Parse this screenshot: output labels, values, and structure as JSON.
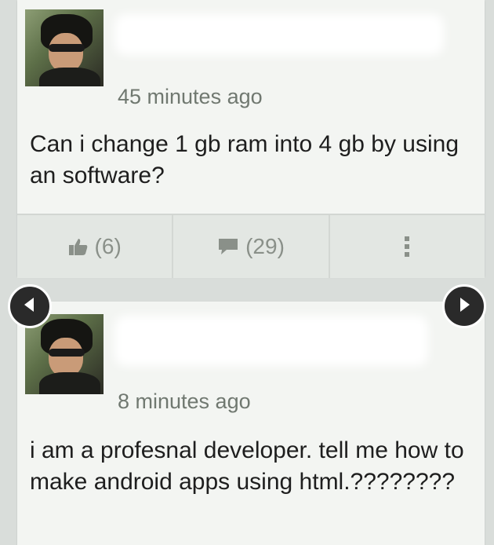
{
  "posts": [
    {
      "time": "45 minutes ago",
      "text": "Can i change 1 gb ram into 4 gb by using an software?",
      "likes": "(6)",
      "comments": "(29)"
    },
    {
      "time": "8 minutes ago",
      "text": "i am a profesnal developer. tell me how to make android apps using html.????????"
    }
  ],
  "icons": {
    "like": "thumbs-up-icon",
    "comment": "comment-icon",
    "more": "more-vertical-icon",
    "prev": "chevron-left-icon",
    "next": "chevron-right-icon"
  },
  "colors": {
    "card": "#f3f5f2",
    "action_bar": "#e3e7e3",
    "muted_text": "#707870",
    "arrow_bg": "#2a2a2a"
  }
}
